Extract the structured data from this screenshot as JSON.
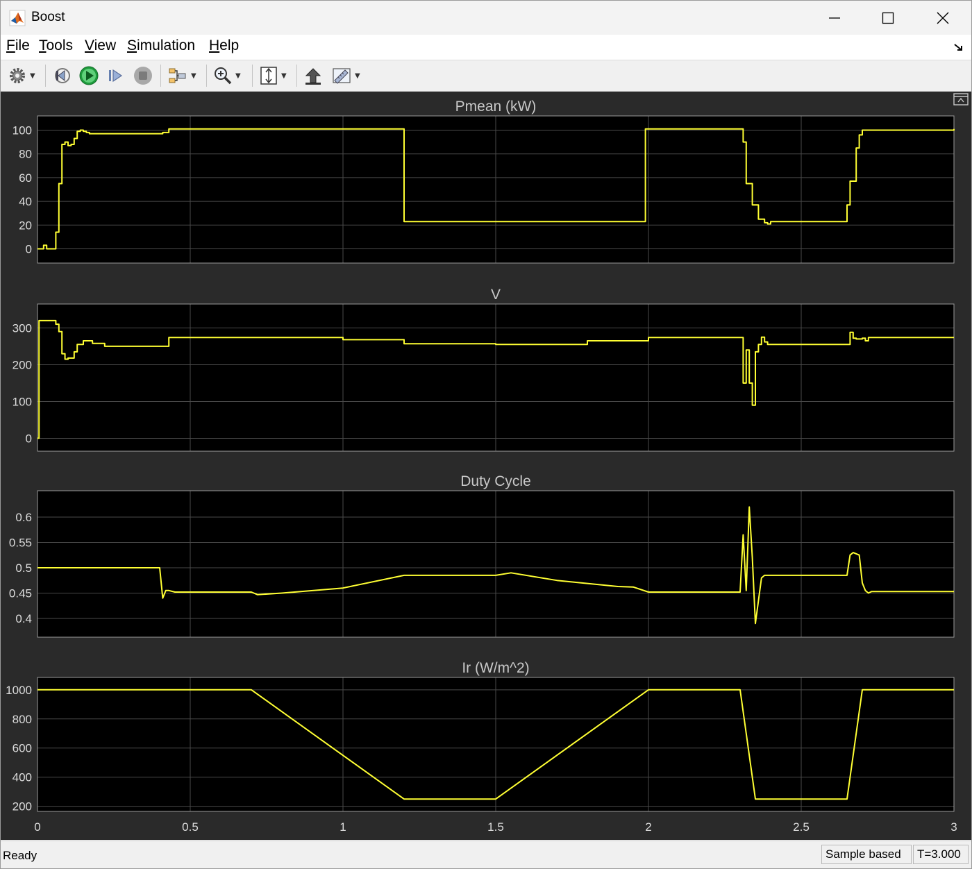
{
  "window": {
    "title": "Boost",
    "controls": [
      "minimize",
      "maximize",
      "close"
    ]
  },
  "menu": [
    {
      "label": "File",
      "key": "F",
      "rest": "ile"
    },
    {
      "label": "Tools",
      "key": "T",
      "rest": "ools"
    },
    {
      "label": "View",
      "key": "V",
      "rest": "iew"
    },
    {
      "label": "Simulation",
      "key": "S",
      "rest": "imulation"
    },
    {
      "label": "Help",
      "key": "H",
      "rest": "elp"
    }
  ],
  "toolbar": {
    "icons": [
      "gear-icon",
      "step-back-icon",
      "run-icon",
      "step-forward-icon",
      "stop-icon",
      "signal-selector-icon",
      "zoom-in-icon",
      "autoscale-icon",
      "highlight-icon",
      "measure-icon"
    ]
  },
  "colors": {
    "trace": "#ffff33",
    "axes_bg": "#000000",
    "figure_bg": "#2a2a2a",
    "grid": "#4a4a4a",
    "text": "#dcdcdc"
  },
  "chart_data": [
    {
      "type": "line",
      "title": "Pmean (kW)",
      "xlim": [
        0,
        3
      ],
      "ylim": [
        -12,
        112
      ],
      "yticks": [
        0,
        20,
        40,
        60,
        80,
        100
      ],
      "ytick_labels": [
        "0",
        "20",
        "40",
        "60",
        "80",
        "100"
      ],
      "grid": true,
      "step": true,
      "x": [
        0,
        0.02,
        0.03,
        0.06,
        0.07,
        0.08,
        0.09,
        0.1,
        0.11,
        0.12,
        0.13,
        0.14,
        0.15,
        0.16,
        0.17,
        0.2,
        0.41,
        0.43,
        0.7,
        1.2,
        1.5,
        1.99,
        2.3,
        2.31,
        2.32,
        2.34,
        2.36,
        2.38,
        2.39,
        2.4,
        2.6,
        2.65,
        2.66,
        2.68,
        2.69,
        2.7,
        3.0
      ],
      "y": [
        0,
        3,
        0,
        14,
        55,
        88,
        90,
        87,
        88,
        93,
        99,
        100,
        99,
        98,
        97,
        97,
        98,
        101,
        101,
        23,
        23,
        101,
        101,
        90,
        55,
        37,
        25,
        22,
        21,
        23,
        23,
        37,
        57,
        85,
        96,
        100,
        101
      ]
    },
    {
      "type": "line",
      "title": "V",
      "xlim": [
        0,
        3
      ],
      "ylim": [
        -35,
        365
      ],
      "yticks": [
        0,
        100,
        200,
        300
      ],
      "ytick_labels": [
        "0",
        "100",
        "200",
        "300"
      ],
      "grid": true,
      "step": true,
      "x": [
        0,
        0.005,
        0.06,
        0.07,
        0.08,
        0.09,
        0.1,
        0.12,
        0.13,
        0.15,
        0.18,
        0.22,
        0.41,
        0.43,
        0.7,
        1.0,
        1.2,
        1.5,
        1.8,
        2.0,
        2.3,
        2.31,
        2.32,
        2.33,
        2.34,
        2.35,
        2.36,
        2.37,
        2.38,
        2.39,
        2.4,
        2.65,
        2.66,
        2.67,
        2.68,
        2.7,
        2.71,
        2.72,
        3.0
      ],
      "y": [
        0,
        320,
        310,
        290,
        230,
        215,
        218,
        235,
        255,
        265,
        258,
        250,
        250,
        274,
        274,
        268,
        257,
        255,
        265,
        274,
        274,
        150,
        240,
        150,
        90,
        235,
        255,
        275,
        262,
        255,
        255,
        255,
        288,
        272,
        270,
        272,
        265,
        274,
        274
      ]
    },
    {
      "type": "line",
      "title": "Duty Cycle",
      "xlim": [
        0,
        3
      ],
      "ylim": [
        0.363,
        0.652
      ],
      "yticks": [
        0.4,
        0.45,
        0.5,
        0.55,
        0.6
      ],
      "ytick_labels": [
        "0.4",
        "0.45",
        "0.5",
        "0.55",
        "0.6"
      ],
      "grid": true,
      "step": false,
      "x": [
        0,
        0.4,
        0.41,
        0.42,
        0.43,
        0.45,
        0.5,
        0.7,
        0.72,
        0.8,
        1.0,
        1.2,
        1.5,
        1.55,
        1.7,
        1.9,
        1.95,
        2.0,
        2.3,
        2.31,
        2.32,
        2.33,
        2.34,
        2.35,
        2.37,
        2.38,
        2.4,
        2.65,
        2.66,
        2.67,
        2.69,
        2.7,
        2.71,
        2.72,
        2.73,
        3.0
      ],
      "y": [
        0.5,
        0.5,
        0.44,
        0.455,
        0.455,
        0.452,
        0.452,
        0.452,
        0.447,
        0.45,
        0.46,
        0.485,
        0.485,
        0.49,
        0.475,
        0.463,
        0.462,
        0.452,
        0.452,
        0.565,
        0.455,
        0.62,
        0.52,
        0.39,
        0.48,
        0.485,
        0.485,
        0.485,
        0.525,
        0.53,
        0.525,
        0.47,
        0.455,
        0.45,
        0.453,
        0.453
      ]
    },
    {
      "type": "line",
      "title": "Ir (W/m^2)",
      "xlim": [
        0,
        3
      ],
      "ylim": [
        165,
        1085
      ],
      "yticks": [
        200,
        400,
        600,
        800,
        1000
      ],
      "ytick_labels": [
        "200",
        "400",
        "600",
        "800",
        "1000"
      ],
      "xticks": [
        0,
        0.5,
        1,
        1.5,
        2,
        2.5,
        3
      ],
      "xtick_labels": [
        "0",
        "0.5",
        "1",
        "1.5",
        "2",
        "2.5",
        "3"
      ],
      "grid": true,
      "step": false,
      "x": [
        0,
        0.7,
        1.2,
        1.5,
        2.0,
        2.3,
        2.35,
        2.65,
        2.7,
        3.0
      ],
      "y": [
        1000,
        1000,
        250,
        250,
        1000,
        1000,
        250,
        250,
        1000,
        1000
      ]
    }
  ],
  "status": {
    "text": "Ready",
    "mode": "Sample based",
    "time": "T=3.000"
  }
}
